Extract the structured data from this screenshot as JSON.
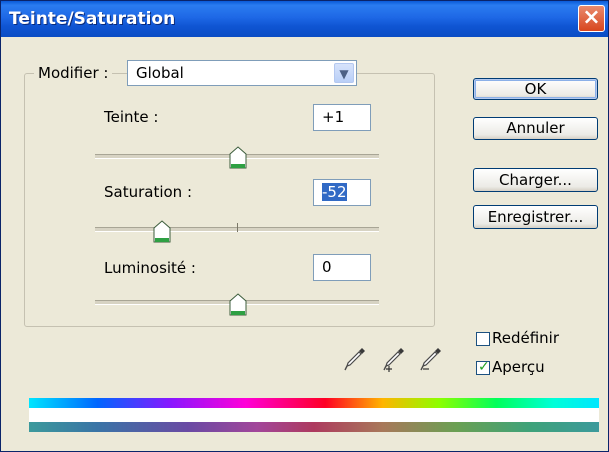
{
  "window": {
    "title": "Teinte/Saturation",
    "close_icon": "×"
  },
  "modifier": {
    "label": "Modifier :",
    "value": "Global"
  },
  "teinte": {
    "label": "Teinte :",
    "value": "+1"
  },
  "saturation": {
    "label": "Saturation :",
    "value": "-52"
  },
  "luminosite": {
    "label": "Luminosité :",
    "value": "0"
  },
  "buttons": {
    "ok": "OK",
    "cancel": "Annuler",
    "load": "Charger...",
    "save": "Enregistrer..."
  },
  "options": {
    "colorize_label": "Redéfinir",
    "colorize_checked": false,
    "preview_label": "Aperçu",
    "preview_checked": true
  },
  "icons": [
    "eyedropper-icon",
    "eyedropper-plus-icon",
    "eyedropper-minus-icon"
  ]
}
